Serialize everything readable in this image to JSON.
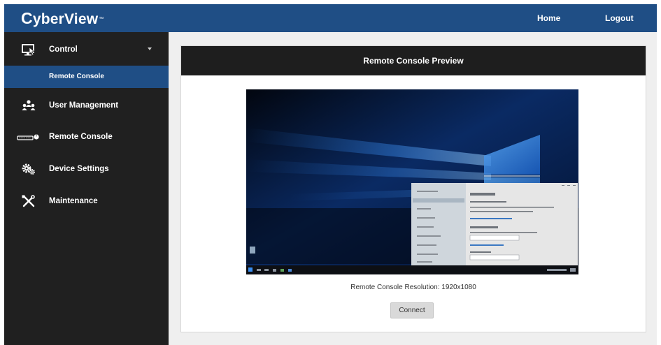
{
  "header": {
    "logo_initial": "C",
    "logo_rest": "yberView",
    "logo_tm": "™",
    "nav": {
      "home": "Home",
      "logout": "Logout"
    },
    "color": "#1f4e85"
  },
  "sidebar": {
    "control": {
      "label": "Control",
      "icon": "monitor-icon"
    },
    "control_sub": {
      "label": "Remote Console"
    },
    "items": [
      {
        "label": "User Management",
        "icon": "users-icon"
      },
      {
        "label": "Remote Console",
        "icon": "keyboard-mouse-icon"
      },
      {
        "label": "Device Settings",
        "icon": "gears-icon"
      },
      {
        "label": "Maintenance",
        "icon": "tools-icon"
      }
    ],
    "active_color": "#1f4e85",
    "background": "#202020"
  },
  "main": {
    "title": "Remote Console Preview",
    "resolution_text": "Remote Console Resolution: 1920x1080",
    "connect_label": "Connect"
  }
}
